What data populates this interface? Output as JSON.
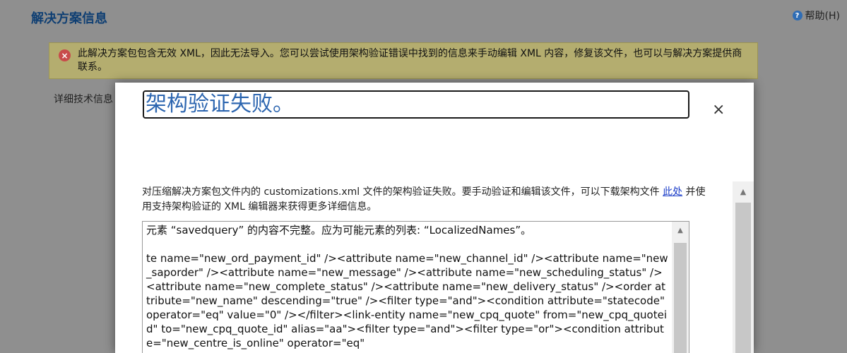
{
  "header": {
    "title": "解决方案信息",
    "help_label": "帮助(H)"
  },
  "error_banner": {
    "message": "此解决方案包包含无效 XML，因此无法导入。您可以尝试使用架构验证错误中找到的信息来手动编辑 XML 内容，修复该文件，也可以与解决方案提供商联系。"
  },
  "details_label": "详细技术信息",
  "dialog": {
    "title": "架构验证失败。",
    "close_glyph": "×",
    "description_before": "对压缩解决方案包文件内的 customizations.xml 文件的架构验证失败。要手动验证和编辑该文件，可以下载架构文件 ",
    "description_link": "此处",
    "description_after": " 并使用支持架构验证的 XML 编辑器来获得更多详细信息。",
    "details_text": "元素 “savedquery” 的内容不完整。应为可能元素的列表: “LocalizedNames”。\n\nte name=\"new_ord_payment_id\" /><attribute name=\"new_channel_id\" /><attribute name=\"new_saporder\" /><attribute name=\"new_message\" /><attribute name=\"new_scheduling_status\" /><attribute name=\"new_complete_status\" /><attribute name=\"new_delivery_status\" /><order attribute=\"new_name\" descending=\"true\" /><filter type=\"and\"><condition attribute=\"statecode\" operator=\"eq\" value=\"0\" /></filter><link-entity name=\"new_cpq_quote\" from=\"new_cpq_quoteid\" to=\"new_cpq_quote_id\" alias=\"aa\"><filter type=\"and\"><filter type=\"or\"><condition attribute=\"new_centre_is_online\" operator=\"eq\""
  },
  "colors": {
    "overlay_bg": "#8f8f8f",
    "page_title": "#0f3f73",
    "banner_bg": "#b4ad6f",
    "dialog_title": "#2d66b0",
    "error_icon": "#c84b4b",
    "link": "#1a3cc8"
  },
  "icons": {
    "help": "help-icon",
    "error": "error-x-icon",
    "close": "close-icon",
    "scroll_up": "scroll-up-arrow-icon"
  }
}
